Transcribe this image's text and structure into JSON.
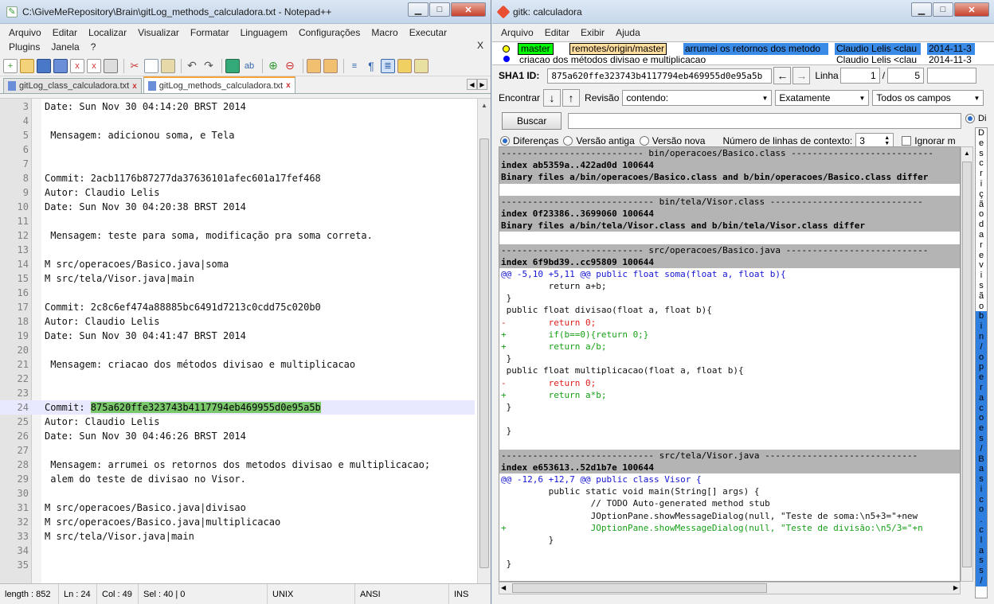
{
  "notepad": {
    "title": "C:\\GiveMeRepository\\Brain\\gitLog_methods_calculadora.txt - Notepad++",
    "menu": [
      "Arquivo",
      "Editar",
      "Localizar",
      "Visualizar",
      "Formatar",
      "Linguagem",
      "Configurações",
      "Macro",
      "Executar",
      "Plugins",
      "Janela",
      "?"
    ],
    "menu_close": "X",
    "tabs": [
      {
        "label": "gitLog_class_calculadora.txt",
        "close": "x"
      },
      {
        "label": "gitLog_methods_calculadora.txt",
        "close": "x"
      }
    ],
    "lines": [
      {
        "n": "3",
        "text": "Date: Sun Nov 30 04:14:20 BRST 2014"
      },
      {
        "n": "4",
        "text": ""
      },
      {
        "n": "5",
        "text": " Mensagem: adicionou soma, e Tela"
      },
      {
        "n": "6",
        "text": ""
      },
      {
        "n": "7",
        "text": ""
      },
      {
        "n": "8",
        "text": "Commit: 2acb1176b87277da37636101afec601a17fef468"
      },
      {
        "n": "9",
        "text": "Autor: Claudio Lelis"
      },
      {
        "n": "10",
        "text": "Date: Sun Nov 30 04:20:38 BRST 2014"
      },
      {
        "n": "11",
        "text": ""
      },
      {
        "n": "12",
        "text": " Mensagem: teste para soma, modificação pra soma correta."
      },
      {
        "n": "13",
        "text": ""
      },
      {
        "n": "14",
        "text": "M src/operacoes/Basico.java|soma"
      },
      {
        "n": "15",
        "text": "M src/tela/Visor.java|main"
      },
      {
        "n": "16",
        "text": ""
      },
      {
        "n": "17",
        "text": "Commit: 2c8c6ef474a88885bc6491d7213c0cdd75c020b0"
      },
      {
        "n": "18",
        "text": "Autor: Claudio Lelis"
      },
      {
        "n": "19",
        "text": "Date: Sun Nov 30 04:41:47 BRST 2014"
      },
      {
        "n": "20",
        "text": ""
      },
      {
        "n": "21",
        "text": " Mensagem: criacao dos métodos divisao e multiplicacao"
      },
      {
        "n": "22",
        "text": ""
      },
      {
        "n": "23",
        "text": ""
      },
      {
        "n": "24",
        "text": "Commit: ",
        "highlight": "875a620ffe323743b4117794eb469955d0e95a5b"
      },
      {
        "n": "25",
        "text": "Autor: Claudio Lelis"
      },
      {
        "n": "26",
        "text": "Date: Sun Nov 30 04:46:26 BRST 2014"
      },
      {
        "n": "27",
        "text": ""
      },
      {
        "n": "28",
        "text": " Mensagem: arrumei os retornos dos metodos divisao e multiplicacao;"
      },
      {
        "n": "29",
        "text": " alem do teste de divisao no Visor."
      },
      {
        "n": "30",
        "text": ""
      },
      {
        "n": "31",
        "text": "M src/operacoes/Basico.java|divisao"
      },
      {
        "n": "32",
        "text": "M src/operacoes/Basico.java|multiplicacao"
      },
      {
        "n": "33",
        "text": "M src/tela/Visor.java|main"
      },
      {
        "n": "34",
        "text": ""
      },
      {
        "n": "35",
        "text": ""
      }
    ],
    "status": {
      "length": "length : 852",
      "ln": "Ln : 24",
      "col": "Col : 49",
      "sel": "Sel : 40 | 0",
      "eol": "UNIX",
      "enc": "ANSI",
      "ins": "INS"
    }
  },
  "gitk": {
    "title": "gitk: calculadora",
    "menu": [
      "Arquivo",
      "Editar",
      "Exibir",
      "Ajuda"
    ],
    "commits": [
      {
        "branch": "master",
        "remote": "remotes/origin/master",
        "msg": "arrumei os retornos dos metodo",
        "author": "Claudio Lelis <clau",
        "date": "2014-11-3"
      },
      {
        "msg": "criacao dos métodos divisao e multiplicacao",
        "author": "Claudio Lelis <clau",
        "date": "2014-11-3"
      }
    ],
    "sha_label": "SHA1 ID:",
    "sha_value": "875a620ffe323743b4117794eb469955d0e95a5b",
    "linha_label": "Linha",
    "linha_cur": "1",
    "linha_sep": "/",
    "linha_total": "5",
    "find_label": "Encontrar",
    "revisao_label": "Revisão",
    "contendo": "contendo:",
    "exatamente": "Exatamente",
    "todos": "Todos os campos",
    "buscar": "Buscar",
    "opt_diff": "Diferenças",
    "opt_old": "Versão antiga",
    "opt_new": "Versão nova",
    "context_label": "Número de linhas de contexto:",
    "context_value": "3",
    "ignore_label": "Ignorar m",
    "filelist_label": "Di",
    "diff": [
      {
        "t": "hdr",
        "s": "--------------------------- bin/operacoes/Basico.class ---------------------------"
      },
      {
        "t": "idx",
        "s": "index ab5359a..422ad0d 100644"
      },
      {
        "t": "bin",
        "s": "Binary files a/bin/operacoes/Basico.class and b/bin/operacoes/Basico.class differ"
      },
      {
        "t": "ctx",
        "s": ""
      },
      {
        "t": "hdr",
        "s": "----------------------------- bin/tela/Visor.class -----------------------------"
      },
      {
        "t": "idx",
        "s": "index 0f23386..3699060 100644"
      },
      {
        "t": "bin",
        "s": "Binary files a/bin/tela/Visor.class and b/bin/tela/Visor.class differ"
      },
      {
        "t": "ctx",
        "s": ""
      },
      {
        "t": "hdr",
        "s": "--------------------------- src/operacoes/Basico.java ---------------------------"
      },
      {
        "t": "idx",
        "s": "index 6f9bd39..cc95809 100644"
      },
      {
        "t": "hunk",
        "s": "@@ -5,10 +5,11 @@ public float soma(float a, float b){"
      },
      {
        "t": "ctx",
        "s": "         return a+b;"
      },
      {
        "t": "ctx",
        "s": " }"
      },
      {
        "t": "ctx",
        "s": " public float divisao(float a, float b){"
      },
      {
        "t": "del",
        "s": "-        return 0;"
      },
      {
        "t": "add",
        "s": "+        if(b==0){return 0;}"
      },
      {
        "t": "add",
        "s": "+        return a/b;"
      },
      {
        "t": "ctx",
        "s": " }"
      },
      {
        "t": "ctx",
        "s": " public float multiplicacao(float a, float b){"
      },
      {
        "t": "del",
        "s": "-        return 0;"
      },
      {
        "t": "add",
        "s": "+        return a*b;"
      },
      {
        "t": "ctx",
        "s": " }"
      },
      {
        "t": "ctx",
        "s": ""
      },
      {
        "t": "ctx",
        "s": " }"
      },
      {
        "t": "ctx",
        "s": ""
      },
      {
        "t": "hdr",
        "s": "----------------------------- src/tela/Visor.java -----------------------------"
      },
      {
        "t": "idx",
        "s": "index e653613..52d1b7e 100644"
      },
      {
        "t": "hunk",
        "s": "@@ -12,6 +12,7 @@ public class Visor {"
      },
      {
        "t": "ctx",
        "s": "         public static void main(String[] args) {"
      },
      {
        "t": "ctx",
        "s": "                 // TODO Auto-generated method stub"
      },
      {
        "t": "ctx",
        "s": "                 JOptionPane.showMessageDialog(null, \"Teste de soma:\\n5+3=\"+new"
      },
      {
        "t": "add",
        "s": "+                JOptionPane.showMessageDialog(null, \"Teste de divisão:\\n5/3=\"+n"
      },
      {
        "t": "ctx",
        "s": "         }"
      },
      {
        "t": "ctx",
        "s": ""
      },
      {
        "t": "ctx",
        "s": " }"
      }
    ],
    "filelist_chars": [
      "D",
      "e",
      "s",
      "c",
      "r",
      "i",
      "ç",
      "ã",
      "o",
      "d",
      "a",
      "r",
      "e",
      "v",
      "i",
      "s",
      "ã",
      "o",
      "b",
      "i",
      "n",
      "/",
      "o",
      "p",
      "e",
      "r",
      "a",
      "c",
      "o",
      "e",
      "s",
      "/",
      "B",
      "a",
      "s",
      "i",
      "c",
      "o",
      ".",
      "c",
      "l",
      "a",
      "s",
      "s",
      "/"
    ]
  }
}
